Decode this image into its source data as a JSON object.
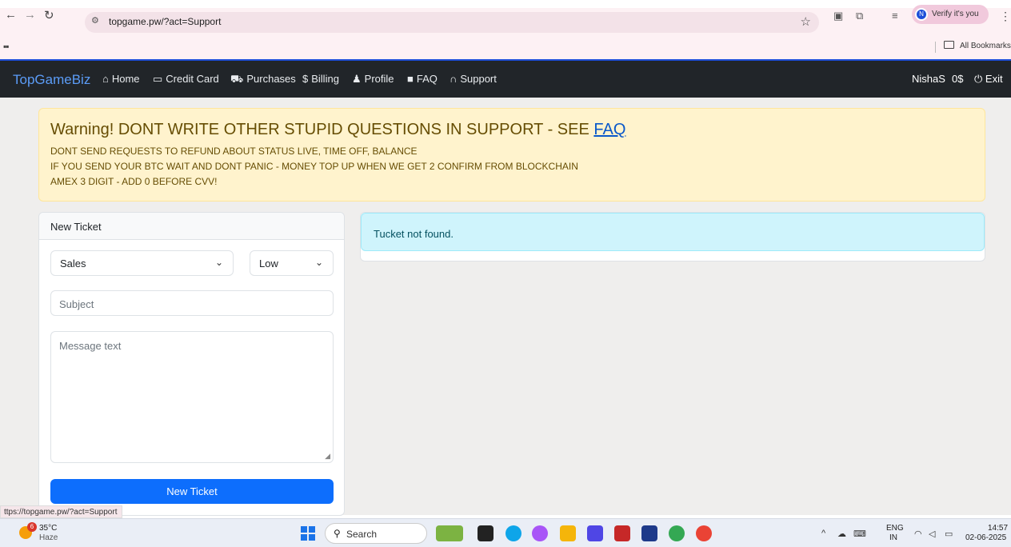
{
  "browser": {
    "url": "topgame.pw/?act=Support",
    "verify_label": "Verify it's you",
    "verify_avatar": "N",
    "bookmarks_label": "All Bookmarks",
    "status_url": "ttps://topgame.pw/?act=Support"
  },
  "site_nav": {
    "brand": "TopGameBiz",
    "items": [
      {
        "label": "Home",
        "icon": "home-icon"
      },
      {
        "label": "Credit Card",
        "icon": "credit-card-icon"
      },
      {
        "label": "Purchases",
        "icon": "cart-icon"
      },
      {
        "label": "Billing",
        "icon": "dollar-icon"
      },
      {
        "label": "Profile",
        "icon": "user-icon"
      },
      {
        "label": "FAQ",
        "icon": "book-icon"
      },
      {
        "label": "Support",
        "icon": "headphones-icon"
      }
    ],
    "username": "NishaS",
    "balance": "0$",
    "exit_label": "Exit"
  },
  "warning": {
    "title_prefix": "Warning! DONT WRITE OTHER STUPID QUESTIONS IN SUPPORT - SEE ",
    "title_link": "FAQ",
    "lines": [
      "DONT SEND REQUESTS TO REFUND ABOUT STATUS LIVE, TIME OFF, BALANCE",
      "IF YOU SEND YOUR BTC WAIT AND DONT PANIC - MONEY TOP UP WHEN WE GET 2 CONFIRM FROM BLOCKCHAIN",
      "AMEX 3 DIGIT - ADD 0 BEFORE CVV!"
    ]
  },
  "new_ticket": {
    "header": "New Ticket",
    "department": "Sales",
    "priority": "Low",
    "subject_placeholder": "Subject",
    "message_placeholder": "Message text",
    "submit_label": "New Ticket"
  },
  "tickets": {
    "message": "Tucket not found."
  },
  "taskbar": {
    "weather_badge": "6",
    "temperature": "35°C",
    "condition": "Haze",
    "search_label": "Search",
    "lang": "ENG",
    "region": "IN",
    "time": "14:57",
    "date": "02-06-2025"
  },
  "colors": {
    "navbar_bg": "#212529",
    "brand": "#5b9cf7",
    "warning_bg": "#fff3cd",
    "info_bg": "#cff4fc",
    "primary": "#0d6efd"
  }
}
